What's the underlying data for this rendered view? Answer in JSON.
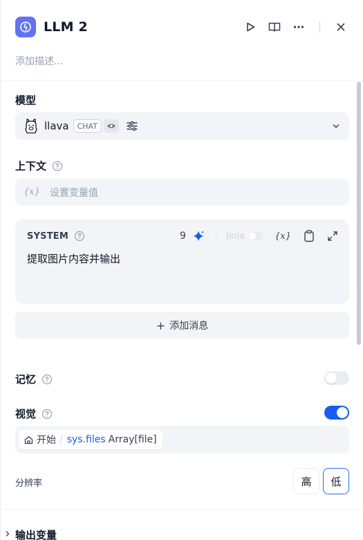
{
  "header": {
    "title": "LLM 2",
    "description_placeholder": "添加描述..."
  },
  "model": {
    "label": "模型",
    "name": "llava",
    "mode_badge": "CHAT"
  },
  "context": {
    "label": "上下文",
    "placeholder": "设置变量值",
    "var_glyph": "{x}"
  },
  "system_prompt": {
    "label": "SYSTEM",
    "token_count": "9",
    "jinja_label": "Jinja",
    "var_glyph": "{x}",
    "text": "提取图片内容并输出"
  },
  "add_message": {
    "plus": "+",
    "label": "添加消息"
  },
  "memory": {
    "label": "记忆",
    "enabled": false
  },
  "vision": {
    "label": "视觉",
    "enabled": true,
    "variable": {
      "node": "开始",
      "separator": "/",
      "name": "sys.files",
      "type": "Array[file]"
    },
    "resolution": {
      "label": "分辨率",
      "options": [
        "高",
        "低"
      ],
      "selected": "低"
    }
  },
  "output": {
    "label": "输出变量"
  },
  "colors": {
    "accent": "#155eef",
    "node_icon_bg": "#6172f3",
    "field_bg": "#f2f4f7"
  }
}
